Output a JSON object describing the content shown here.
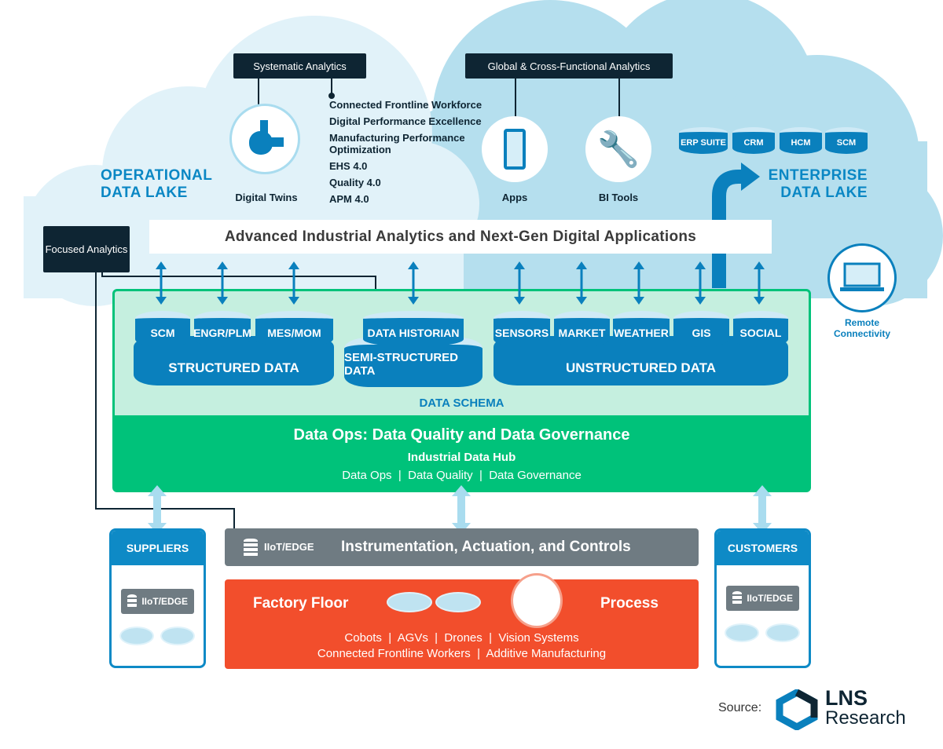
{
  "colors": {
    "navy": "#0e2533",
    "blue": "#0a80bd",
    "green": "#00c27a",
    "light_green": "#c5efdf",
    "gray": "#6f7b82",
    "orange": "#f24e2c",
    "cloud_left": "#e1f2f9",
    "cloud_right": "#b5dfee"
  },
  "top": {
    "systematic": "Systematic Analytics",
    "global": "Global & Cross-Functional Analytics",
    "focused": "Focused Analytics",
    "list": [
      "Connected Frontline Workforce",
      "Digital Performance Excellence",
      "Manufacturing Performance Optimization",
      "EHS 4.0",
      "Quality 4.0",
      "APM 4.0"
    ],
    "digital_twins": "Digital Twins",
    "apps": "Apps",
    "bi_tools": "BI Tools",
    "operational_lake": [
      "OPERATIONAL",
      "DATA LAKE"
    ],
    "enterprise_lake": [
      "ENTERPRISE",
      "DATA LAKE"
    ],
    "enterprise": [
      "ERP SUITE",
      "CRM",
      "HCM",
      "SCM"
    ],
    "analytics_bar": "Advanced Industrial Analytics and Next-Gen Digital Applications",
    "remote": [
      "Remote",
      "Connectivity"
    ]
  },
  "data": {
    "structured": [
      "SCM",
      "ENGR/PLM",
      "MES/MOM"
    ],
    "structured_label": "STRUCTURED DATA",
    "semi": "DATA HISTORIAN",
    "semi_label": "SEMI-STRUCTURED DATA",
    "unstructured": [
      "SENSORS",
      "MARKET",
      "WEATHER",
      "GIS",
      "SOCIAL"
    ],
    "unstructured_label": "UNSTRUCTURED DATA",
    "schema": "DATA SCHEMA",
    "ops_title": "Data Ops: Data Quality and Data Governance",
    "hub": "Industrial Data Hub",
    "hub_items": "Data Ops  |  Data Quality  |  Data Governance"
  },
  "bottom": {
    "suppliers": "SUPPLIERS",
    "customers": "CUSTOMERS",
    "edge": "IIoT/EDGE",
    "iac": "Instrumentation, Actuation, and Controls",
    "factory": "Factory Floor",
    "process": "Process",
    "line1": "Cobots  |  AGVs  |  Drones  |  Vision Systems",
    "line2": "Connected Frontline Workers  |  Additive Manufacturing"
  },
  "source": {
    "label": "Source:",
    "brand1": "LNS",
    "brand2": "Research"
  }
}
